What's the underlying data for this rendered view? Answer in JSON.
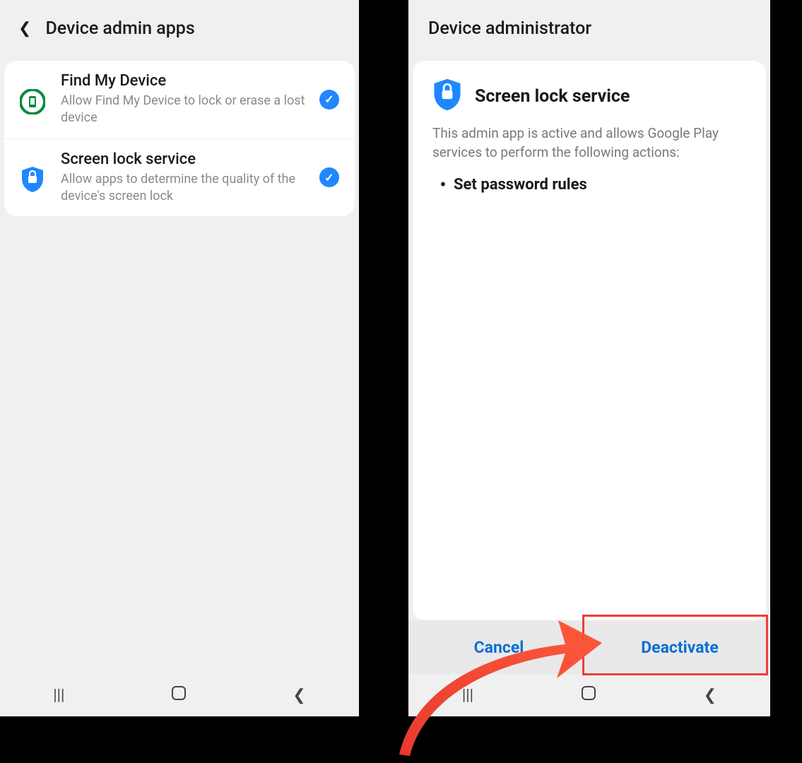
{
  "screen1": {
    "title": "Device admin apps",
    "items": [
      {
        "title": "Find My Device",
        "sub": "Allow Find My Device to lock or erase a lost device",
        "icon": "find-my-device-icon",
        "checked": true
      },
      {
        "title": "Screen lock service",
        "sub": "Allow apps to determine the quality of the device's screen lock",
        "icon": "shield-lock-icon",
        "checked": true
      }
    ]
  },
  "screen2": {
    "title": "Device administrator",
    "app_name": "Screen lock service",
    "description": "This admin app is active and allows Google Play services to perform the following actions:",
    "actions": [
      "Set password rules"
    ],
    "buttons": {
      "cancel": "Cancel",
      "deactivate": "Deactivate"
    }
  },
  "annotation": {
    "highlighted_button": "deactivate"
  }
}
